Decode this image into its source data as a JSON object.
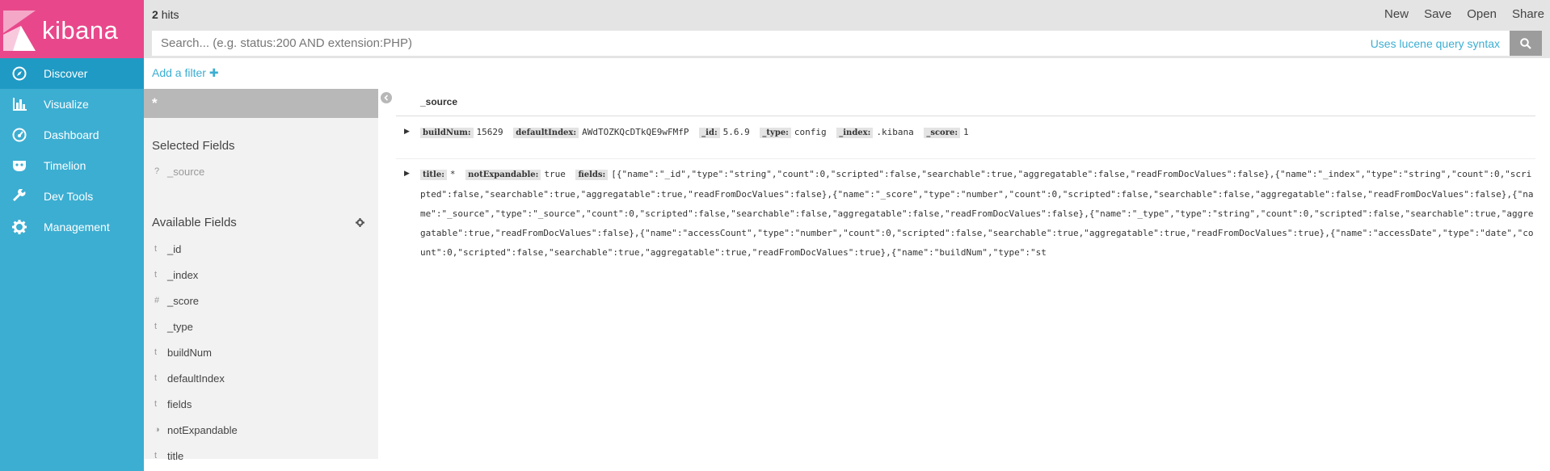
{
  "app": {
    "name": "kibana"
  },
  "nav": {
    "items": [
      {
        "label": "Discover",
        "icon": "compass-icon",
        "active": true
      },
      {
        "label": "Visualize",
        "icon": "bar-chart-icon"
      },
      {
        "label": "Dashboard",
        "icon": "dashboard-gauge-icon"
      },
      {
        "label": "Timelion",
        "icon": "timelion-mask-icon"
      },
      {
        "label": "Dev Tools",
        "icon": "wrench-icon"
      },
      {
        "label": "Management",
        "icon": "gear-icon"
      }
    ]
  },
  "header": {
    "hits_count": "2",
    "hits_label": "hits",
    "menu": {
      "new": "New",
      "save": "Save",
      "open": "Open",
      "share": "Share"
    },
    "search": {
      "placeholder": "Search... (e.g. status:200 AND extension:PHP)",
      "value": "",
      "syntax_link": "Uses lucene query syntax"
    },
    "add_filter": "Add a filter"
  },
  "sidebar": {
    "index_pattern": "*",
    "selected_title": "Selected Fields",
    "selected_fields": [
      {
        "type": "?",
        "name": "_source"
      }
    ],
    "available_title": "Available Fields",
    "available_fields": [
      {
        "type": "t",
        "name": "_id"
      },
      {
        "type": "t",
        "name": "_index"
      },
      {
        "type": "#",
        "name": "_score"
      },
      {
        "type": "t",
        "name": "_type"
      },
      {
        "type": "t",
        "name": "buildNum"
      },
      {
        "type": "t",
        "name": "defaultIndex"
      },
      {
        "type": "t",
        "name": "fields"
      },
      {
        "type": "◑",
        "name": "notExpandable"
      },
      {
        "type": "t",
        "name": "title"
      }
    ]
  },
  "table": {
    "column": "_source",
    "rows": [
      {
        "pairs": [
          {
            "k": "buildNum:",
            "v": "15629"
          },
          {
            "k": "defaultIndex:",
            "v": "AWdTOZKQcDTkQE9wFMfP"
          },
          {
            "k": "_id:",
            "v": "5.6.9"
          },
          {
            "k": "_type:",
            "v": "config"
          },
          {
            "k": "_index:",
            "v": ".kibana"
          },
          {
            "k": "_score:",
            "v": "1"
          }
        ]
      },
      {
        "pairs": [
          {
            "k": "title:",
            "v": "*"
          },
          {
            "k": "notExpandable:",
            "v": "true"
          },
          {
            "k": "fields:",
            "v": "[{\"name\":\"_id\",\"type\":\"string\",\"count\":0,\"scripted\":false,\"searchable\":true,\"aggregatable\":false,\"readFromDocValues\":false},{\"name\":\"_index\",\"type\":\"string\",\"count\":0,\"scripted\":false,\"searchable\":true,\"aggregatable\":true,\"readFromDocValues\":false},{\"name\":\"_score\",\"type\":\"number\",\"count\":0,\"scripted\":false,\"searchable\":false,\"aggregatable\":false,\"readFromDocValues\":false},{\"name\":\"_source\",\"type\":\"_source\",\"count\":0,\"scripted\":false,\"searchable\":false,\"aggregatable\":false,\"readFromDocValues\":false},{\"name\":\"_type\",\"type\":\"string\",\"count\":0,\"scripted\":false,\"searchable\":true,\"aggregatable\":true,\"readFromDocValues\":false},{\"name\":\"accessCount\",\"type\":\"number\",\"count\":0,\"scripted\":false,\"searchable\":true,\"aggregatable\":true,\"readFromDocValues\":true},{\"name\":\"accessDate\",\"type\":\"date\",\"count\":0,\"scripted\":false,\"searchable\":true,\"aggregatable\":true,\"readFromDocValues\":true},{\"name\":\"buildNum\",\"type\":\"st"
          }
        ]
      }
    ]
  },
  "colors": {
    "logo_bg": "#e8488b",
    "nav_bg": "#3caed2",
    "nav_active": "#1f9ac4",
    "link": "#3caed2"
  }
}
